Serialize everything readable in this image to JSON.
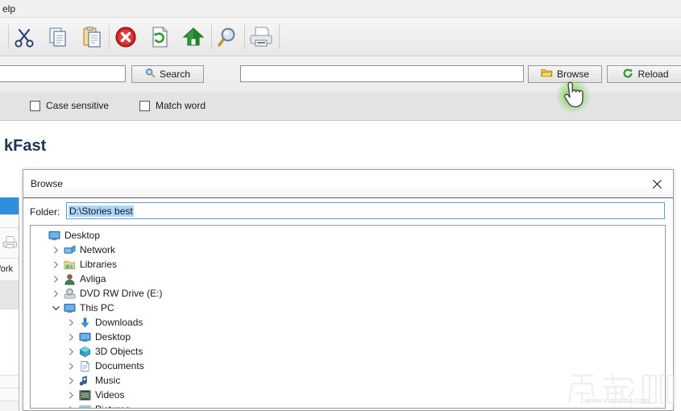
{
  "menu": {
    "visible_item": "elp"
  },
  "toolbar": {
    "buttons": [
      {
        "name": "cut",
        "icon": "scissors-icon",
        "tooltip": "Cut"
      },
      {
        "name": "copy",
        "icon": "copy-icon",
        "tooltip": "Copy"
      },
      {
        "name": "paste",
        "icon": "paste-icon",
        "tooltip": "Paste"
      },
      {
        "name": "stop",
        "icon": "stop-icon",
        "tooltip": "Stop"
      },
      {
        "name": "refresh",
        "icon": "refresh-page-icon",
        "tooltip": "Refresh"
      },
      {
        "name": "home",
        "icon": "home-icon",
        "tooltip": "Home"
      },
      {
        "name": "find",
        "icon": "magnifier-icon",
        "tooltip": "Find"
      },
      {
        "name": "print",
        "icon": "printer-icon",
        "tooltip": "Print"
      }
    ]
  },
  "search_row": {
    "search_input_value": "",
    "search_input_placeholder": "",
    "search_button_label": "Search",
    "path_input_value": "",
    "path_input_placeholder": "",
    "browse_button_label": "Browse",
    "reload_button_label": "Reload"
  },
  "options_row": {
    "case_sensitive_label": "Case sensitive",
    "case_sensitive_checked": false,
    "match_word_label": "Match word",
    "match_word_checked": false
  },
  "page": {
    "app_title": "kFast"
  },
  "left_panel": {
    "rows": [
      {
        "label": "",
        "state": "selected"
      },
      {
        "label": "",
        "state": "normal"
      },
      {
        "label": "",
        "state": "printer"
      },
      {
        "label": "Vork",
        "state": "normal"
      },
      {
        "label": "",
        "state": "gray"
      }
    ]
  },
  "dialog": {
    "title": "Browse",
    "close_label": "✕",
    "folder_label": "Folder:",
    "folder_value": "D:\\Stories best",
    "tree": [
      {
        "label": "Desktop",
        "depth": 0,
        "icon": "monitor-icon",
        "arrow": "none"
      },
      {
        "label": "Network",
        "depth": 1,
        "icon": "network-icon",
        "arrow": "collapsed"
      },
      {
        "label": "Libraries",
        "depth": 1,
        "icon": "libraries-icon",
        "arrow": "collapsed"
      },
      {
        "label": "Avliga",
        "depth": 1,
        "icon": "user-icon",
        "arrow": "collapsed"
      },
      {
        "label": "DVD RW Drive (E:)",
        "depth": 1,
        "icon": "disc-drive-icon",
        "arrow": "collapsed"
      },
      {
        "label": "This PC",
        "depth": 1,
        "icon": "monitor-icon",
        "arrow": "expanded"
      },
      {
        "label": "Downloads",
        "depth": 2,
        "icon": "download-icon",
        "arrow": "collapsed"
      },
      {
        "label": "Desktop",
        "depth": 2,
        "icon": "monitor-icon",
        "arrow": "collapsed"
      },
      {
        "label": "3D Objects",
        "depth": 2,
        "icon": "cube-icon",
        "arrow": "collapsed"
      },
      {
        "label": "Documents",
        "depth": 2,
        "icon": "document-icon",
        "arrow": "collapsed"
      },
      {
        "label": "Music",
        "depth": 2,
        "icon": "music-note-icon",
        "arrow": "collapsed"
      },
      {
        "label": "Videos",
        "depth": 2,
        "icon": "video-film-icon",
        "arrow": "collapsed"
      },
      {
        "label": "Pictures",
        "depth": 2,
        "icon": "picture-icon",
        "arrow": "collapsed"
      }
    ]
  },
  "cursor": {
    "type": "hand-pointer",
    "highlight_color": "#55bb33"
  },
  "watermark": {
    "text": "下载吧",
    "url": "www.xiazaiba.com"
  },
  "colors": {
    "accent_blue": "#2f8ee0",
    "selection_blue": "#add6ff",
    "title_navy": "#1d3557",
    "toolbar_bg": "#eeeeee",
    "options_bg": "#e3e3e3"
  }
}
